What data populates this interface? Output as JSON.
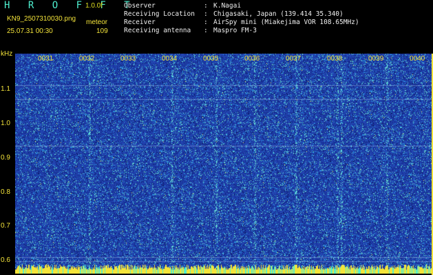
{
  "header": {
    "title": "H R O F F T",
    "version": "1.0.0f",
    "filename": "KN9_2507310030.png",
    "meteor_label": "meteor",
    "datetime": "25.07.31 00:30",
    "meteor_count": "109",
    "info": [
      {
        "key": "Observer",
        "sep": ":",
        "value": "K.Nagai"
      },
      {
        "key": "Receiving Location",
        "sep": ":",
        "value": "Chigasaki, Japan (139.414 35.340)"
      },
      {
        "key": "Receiver",
        "sep": ":",
        "value": "AirSpy mini (Miakejima VOR 108.65MHz)"
      },
      {
        "key": "Receiving antenna",
        "sep": ":",
        "value": "Maspro FM-3"
      }
    ]
  },
  "spectrogram": {
    "y_unit": "kHz",
    "y_ticks": [
      "1.1",
      "1.0",
      "0.9",
      "0.8",
      "0.7",
      "0.6"
    ],
    "x_ticks": [
      "0031",
      "0032",
      "0033",
      "0034",
      "0035",
      "0036",
      "0037",
      "0038",
      "0039",
      "0040"
    ],
    "colors": {
      "background": "#1c3ea8",
      "label": "#f4e43a",
      "cyan": "#4ff0d0"
    }
  }
}
